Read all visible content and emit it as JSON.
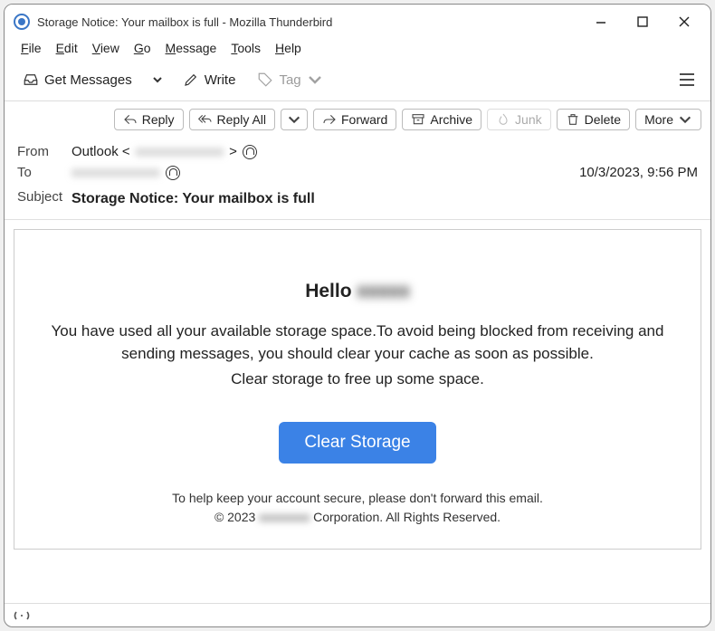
{
  "titlebar": {
    "title": "Storage Notice: Your mailbox is full - Mozilla Thunderbird"
  },
  "menubar": {
    "file": "File",
    "edit": "Edit",
    "view": "View",
    "go": "Go",
    "message": "Message",
    "tools": "Tools",
    "help": "Help"
  },
  "toolbar": {
    "get_messages": "Get Messages",
    "write": "Write",
    "tag": "Tag"
  },
  "actions": {
    "reply": "Reply",
    "reply_all": "Reply All",
    "forward": "Forward",
    "archive": "Archive",
    "junk": "Junk",
    "delete": "Delete",
    "more": "More"
  },
  "headers": {
    "from_label": "From",
    "from_value": "Outlook <",
    "from_blur": "xxxxxxxxxxxxx",
    "from_close": " >",
    "to_label": "To",
    "to_blur": "xxxxxxxxxxxxx",
    "date": "10/3/2023, 9:56 PM",
    "subject_label": "Subject",
    "subject_value": "Storage Notice: Your mailbox is full"
  },
  "email": {
    "hello_prefix": "Hello ",
    "hello_blur": "xxxxx",
    "p1": "You have used all your available storage space.To avoid being blocked from receiving and sending messages, you should clear your cache as soon as possible.",
    "p2": "Clear storage to free up some space.",
    "cta": "Clear Storage",
    "footer1": "To help keep your account secure, please don't forward this email.",
    "footer2a": "© 2023 ",
    "footer2_blur": "xxxxxxxx",
    "footer2b": " Corporation. All Rights Reserved."
  }
}
